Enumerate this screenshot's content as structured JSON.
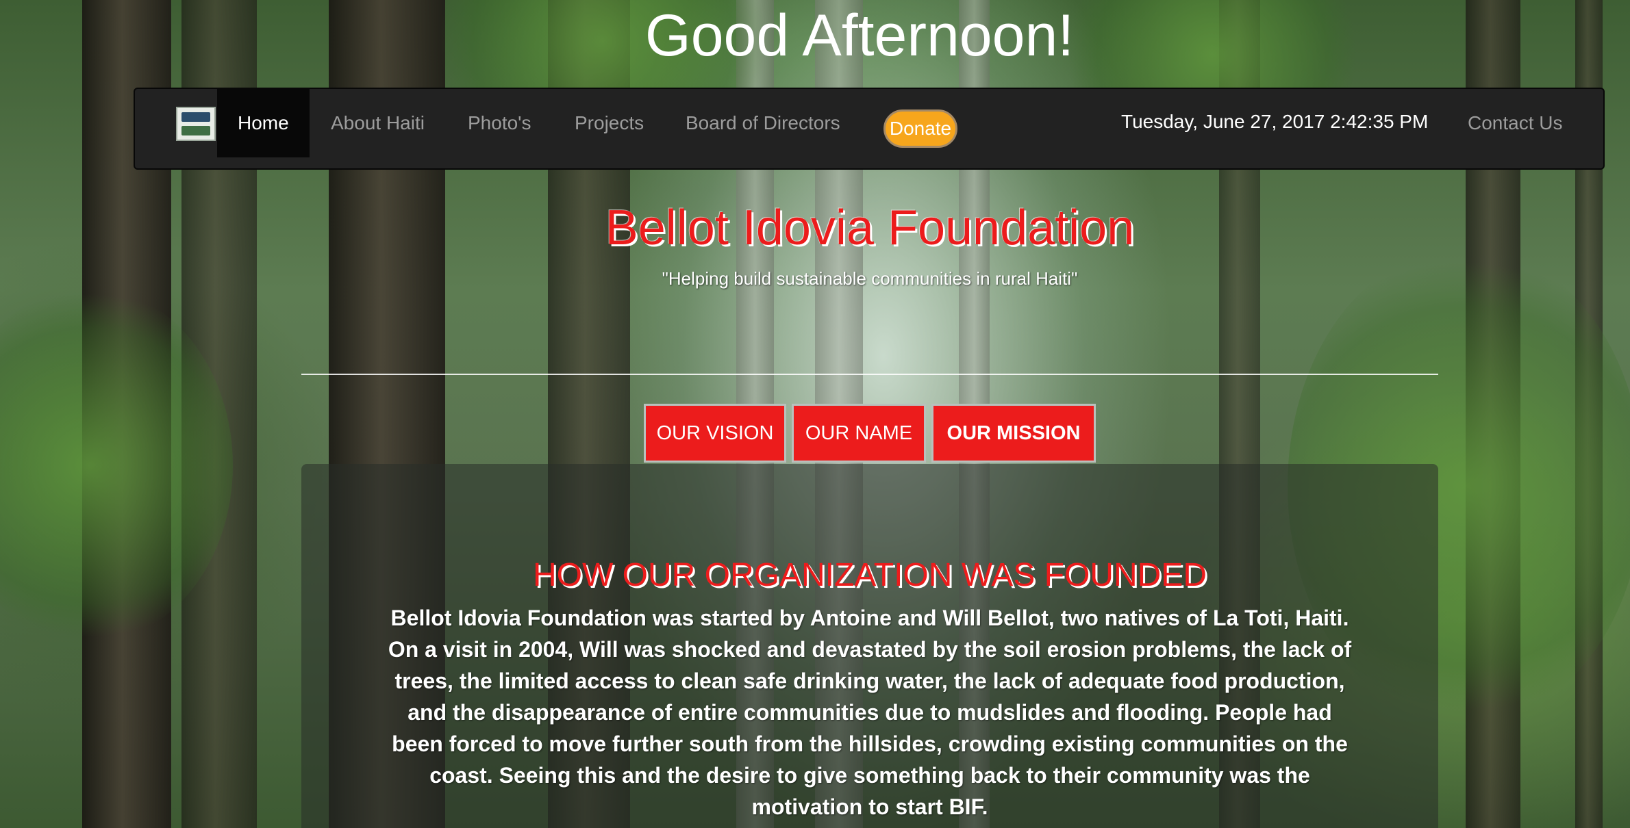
{
  "greeting": "Good Afternoon!",
  "navbar": {
    "logo_alt": "Bellot Idovia Foundation logo",
    "links": {
      "home": "Home",
      "about": "About Haiti",
      "photos": "Photo's",
      "projects": "Projects",
      "board": "Board of Directors",
      "contact": "Contact Us"
    },
    "donate_label": "Donate",
    "datetime": "Tuesday, June 27, 2017 2:42:35 PM"
  },
  "hero": {
    "title": "Bellot Idovia Foundation",
    "tagline": "\"Helping build sustainable communities in rural Haiti\""
  },
  "tabs": {
    "vision": "OUR VISION",
    "name": "OUR NAME",
    "mission": "OUR MISSION"
  },
  "content": {
    "heading": "HOW OUR ORGANIZATION WAS FOUNDED",
    "body": "Bellot Idovia Foundation was started by Antoine and Will Bellot, two natives of La Toti, Haiti. On a visit in 2004, Will was shocked and devastated by the soil erosion problems, the lack of trees, the limited access to clean safe drinking water, the lack of adequate food production, and the disappearance of entire communities due to mudslides and flooding. People had been forced to move further south from the hillsides, crowding existing communities on the coast. Seeing this and the desire to give something back to their community was the motivation to start BIF."
  },
  "colors": {
    "accent_red": "#ec1c1c",
    "donate_orange": "#f7a61c",
    "navbar_bg": "#222222"
  }
}
